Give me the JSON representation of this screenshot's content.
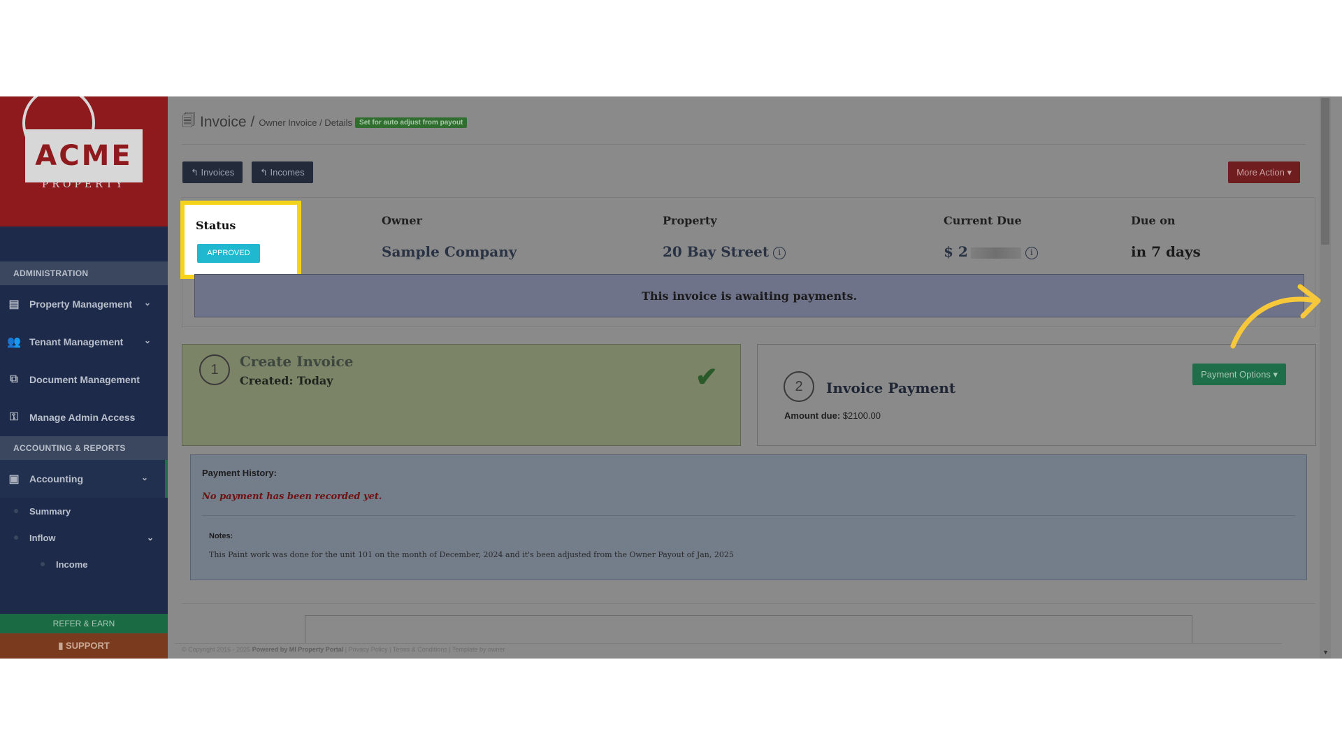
{
  "sidebar": {
    "logo_text": "ACME",
    "logo_sub": "PROPERTY",
    "section_admin": "ADMINISTRATION",
    "admin_items": [
      {
        "label": "Property Management",
        "icon": "building-icon"
      },
      {
        "label": "Tenant Management",
        "icon": "users-icon"
      },
      {
        "label": "Document Management",
        "icon": "documents-icon"
      },
      {
        "label": "Manage Admin Access",
        "icon": "key-icon"
      }
    ],
    "section_accounting": "ACCOUNTING & REPORTS",
    "accounting_label": "Accounting",
    "sub_summary": "Summary",
    "sub_inflow": "Inflow",
    "sub_income": "Income",
    "refer": "REFER & EARN",
    "support": "SUPPORT"
  },
  "header": {
    "title": "Invoice",
    "separator": "/",
    "crumbs": "Owner Invoice / Details",
    "badge": "Set for auto adjust from payout"
  },
  "toolbar": {
    "invoices": "Invoices",
    "incomes": "Incomes",
    "more_action": "More Action"
  },
  "summary": {
    "status_label": "Status",
    "status_value": "APPROVED",
    "owner_label": "Owner",
    "owner_value": "Sample Company",
    "property_label": "Property",
    "property_value": "20 Bay Street",
    "due_label": "Current Due",
    "due_value": "$ 2",
    "due_on_label": "Due on",
    "due_on_value": "in 7 days",
    "awaiting": "This invoice is awaiting payments."
  },
  "steps": {
    "s1_num": "1",
    "s1_title": "Create Invoice",
    "s1_sub": "Created: Today",
    "s2_num": "2",
    "s2_title": "Invoice Payment",
    "payment_options": "Payment Options",
    "amount_label": "Amount due:",
    "amount_value": "$2100.00"
  },
  "history": {
    "label": "Payment History:",
    "empty": "No payment has been recorded yet.",
    "notes_label": "Notes:",
    "notes_text": "This Paint work was done for the unit 101 on the month of December, 2024 and it's been adjusted from the Owner Payout of Jan, 2025"
  },
  "footer": {
    "copyright": "© Copyright 2016 - 2025",
    "powered": "Powered by MI Property Portal",
    "links": "| Privacy Policy | Terms & Conditions |",
    "extra": "Template by owner"
  },
  "colors": {
    "highlight": "#f5d31a",
    "approved": "#1fb8cf",
    "arrow": "#f6c83a"
  }
}
